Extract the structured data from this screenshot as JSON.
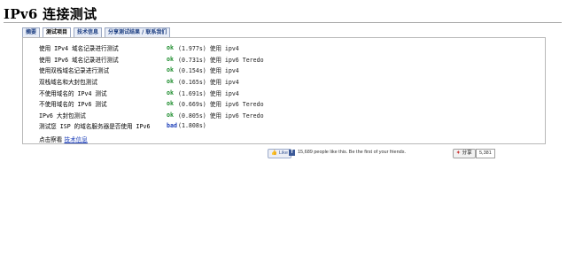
{
  "page": {
    "title": "IPv6 连接测试"
  },
  "tabs": [
    {
      "label": "摘要"
    },
    {
      "label": "测试项目"
    },
    {
      "label": "技术信息"
    },
    {
      "label": "分享测试结果 / 联系我们"
    }
  ],
  "tests": [
    {
      "label": "使用 IPv4 域名记录进行测试",
      "status": "ok",
      "detail": "(1.977s) 使用 ipv4"
    },
    {
      "label": "使用 IPv6 域名记录进行测试",
      "status": "ok",
      "detail": "(0.731s) 使用 ipv6 Teredo"
    },
    {
      "label": "使用双栈域名记录进行测试",
      "status": "ok",
      "detail": "(0.154s) 使用 ipv4"
    },
    {
      "label": "双栈域名和大封包测试",
      "status": "ok",
      "detail": "(0.165s) 使用 ipv4"
    },
    {
      "label": "不使用域名的 IPv4 测试",
      "status": "ok",
      "detail": "(1.691s) 使用 ipv4"
    },
    {
      "label": "不使用域名的 IPv6 测试",
      "status": "ok",
      "detail": "(0.669s) 使用 ipv6 Teredo"
    },
    {
      "label": "IPv6 大封包测试",
      "status": "ok",
      "detail": "(0.805s) 使用 ipv6 Teredo"
    },
    {
      "label": "测试您 ISP 的域名服务器是否使用 IPv6",
      "status": "bad",
      "detail": "(1.808s)"
    }
  ],
  "more": {
    "prefix": "点击察看",
    "link": "技术信息"
  },
  "footer": {
    "like_label": "Like",
    "like_text": "15,689 people like this. Be the first of your friends.",
    "fb_icon": "f",
    "share_label": "分享",
    "share_logo": "✦",
    "share_count": "5,381"
  }
}
